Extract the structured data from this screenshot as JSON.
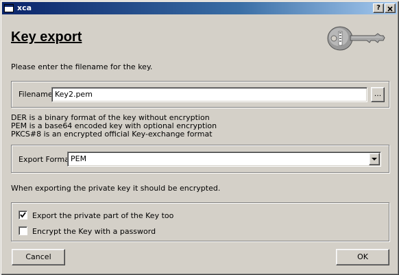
{
  "window": {
    "title": "xca",
    "help_glyph": "?",
    "close_glyph": "X"
  },
  "dialog": {
    "heading": "Key export",
    "intro": "Please enter the filename for the key.",
    "logo_icon": "key-icon"
  },
  "filename": {
    "label": "Filename",
    "value": "Key2.pem",
    "browse_label": "..."
  },
  "format_info": [
    "DER is a binary format of the key without encryption",
    "PEM is a base64 encoded key with optional encryption",
    "PKCS#8 is an encrypted official Key-exchange format"
  ],
  "export_format": {
    "label": "Export Format",
    "selected": "PEM",
    "dropdown_icon": "chevron-down-icon"
  },
  "private_key_note": "When exporting the private key it should be encrypted.",
  "options": [
    {
      "label": "Export the private part of the Key too",
      "checked": true
    },
    {
      "label": "Encrypt the Key with a password",
      "checked": false
    }
  ],
  "buttons": {
    "cancel": "Cancel",
    "ok": "OK"
  }
}
